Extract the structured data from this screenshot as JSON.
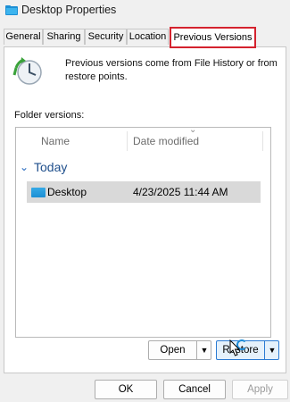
{
  "window": {
    "title": "Desktop Properties",
    "folder_icon": "folder-icon"
  },
  "tabs": [
    {
      "label": "General"
    },
    {
      "label": "Sharing"
    },
    {
      "label": "Security"
    },
    {
      "label": "Location"
    },
    {
      "label": "Previous Versions",
      "active": true
    }
  ],
  "info": {
    "text": "Previous versions come from File History or from restore points.",
    "icon": "file-history-clock-icon"
  },
  "folder_versions_label": "Folder versions:",
  "list": {
    "columns": [
      "Name",
      "Date modified"
    ],
    "groups": [
      {
        "label": "Today",
        "items": [
          {
            "name": "Desktop",
            "date_modified": "4/23/2025 11:44 AM",
            "selected": true
          }
        ]
      }
    ]
  },
  "actions": {
    "open_label": "Open",
    "restore_label": "Restore"
  },
  "dialog_buttons": {
    "ok": "OK",
    "cancel": "Cancel",
    "apply": "Apply"
  },
  "colors": {
    "highlight_border": "#d4222e",
    "accent": "#1a8ad8"
  }
}
